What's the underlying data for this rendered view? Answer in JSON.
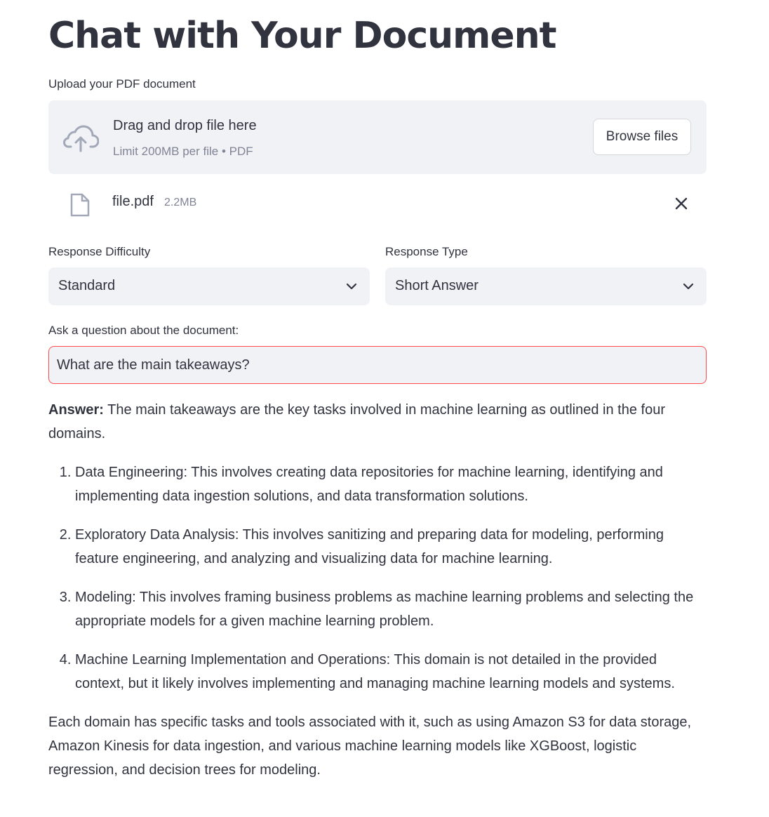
{
  "page": {
    "title": "Chat with Your Document"
  },
  "uploader": {
    "label": "Upload your PDF document",
    "drop_text": "Drag and drop file here",
    "limit_text": "Limit 200MB per file • PDF",
    "browse_label": "Browse files",
    "icon": "cloud-upload-icon"
  },
  "uploaded_file": {
    "name": "file.pdf",
    "size": "2.2MB",
    "icon": "file-icon",
    "remove_icon": "close-icon"
  },
  "difficulty": {
    "label": "Response Difficulty",
    "value": "Standard"
  },
  "response_type": {
    "label": "Response Type",
    "value": "Short Answer"
  },
  "question": {
    "label": "Ask a question about the document:",
    "value": "What are the main takeaways?"
  },
  "answer": {
    "label": "Answer:",
    "intro": "The main takeaways are the key tasks involved in machine learning as outlined in the four domains.",
    "items": [
      "Data Engineering: This involves creating data repositories for machine learning, identifying and implementing data ingestion solutions, and data transformation solutions.",
      "Exploratory Data Analysis: This involves sanitizing and preparing data for modeling, performing feature engineering, and analyzing and visualizing data for machine learning.",
      "Modeling: This involves framing business problems as machine learning problems and selecting the appropriate models for a given machine learning problem.",
      "Machine Learning Implementation and Operations: This domain is not detailed in the provided context, but it likely involves implementing and managing machine learning models and systems."
    ],
    "closing": "Each domain has specific tasks and tools associated with it, such as using Amazon S3 for data storage, Amazon Kinesis for data ingestion, and various machine learning models like XGBoost, logistic regression, and decision trees for modeling."
  },
  "colors": {
    "text": "#31333f",
    "muted": "#808495",
    "surface": "#f0f2f6",
    "error_border": "#ff4b4b"
  }
}
